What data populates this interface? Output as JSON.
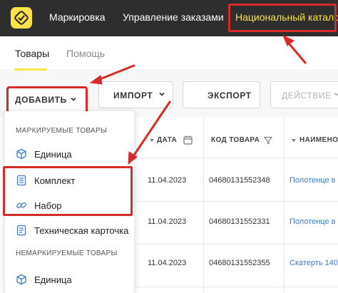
{
  "topnav": {
    "items": [
      "Маркировка",
      "Управление заказами",
      "Национальный каталог"
    ],
    "active_color": "#fde24a"
  },
  "tabs": [
    "Товары",
    "Помощь"
  ],
  "toolbar": {
    "add_label": "ДОБАВИТЬ",
    "import_label": "ИМПОРТ",
    "export_label": "ЭКСПОРТ",
    "action_label": "ДЕЙСТВИЕ"
  },
  "table": {
    "headers": {
      "date": "ДАТА",
      "code": "КОД ТОВАРА",
      "name": "НАИМЕНОВ"
    },
    "rows": [
      {
        "date": "11.04.2023",
        "code": "04680131552348",
        "name": "Полотенце в"
      },
      {
        "date": "11.04.2023",
        "code": "04680131552331",
        "name": "Полотенце в"
      },
      {
        "date": "11.04.2023",
        "code": "04680131552355",
        "name": "Скатерть 140"
      }
    ]
  },
  "dropdown": {
    "group_marked": "МАРКИРУЕМЫЕ ТОВАРЫ",
    "group_unmarked": "НЕМАРКИРУЕМЫЕ ТОВАРЫ",
    "items": [
      "Единица",
      "Комплект",
      "Набор",
      "Техническая карточка",
      "Единица"
    ]
  },
  "colors": {
    "highlight": "#d72a2a",
    "accent": "#fde24a",
    "link": "#3d7bc7",
    "topbar": "#2e2e2e"
  }
}
